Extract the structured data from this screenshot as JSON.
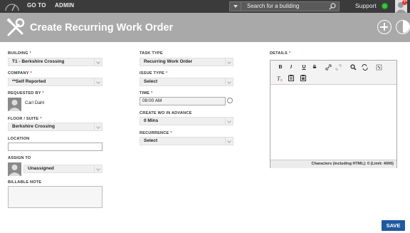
{
  "topbar": {
    "nav_goto": "GO TO",
    "nav_admin": "ADMIN",
    "search_placeholder": "Search for a building",
    "support_label": "Support",
    "status_color": "#2ecc2e",
    "notification_badge": "+"
  },
  "header": {
    "title": "Create Recurring Work Order",
    "band_color": "#a9a9a9"
  },
  "form": {
    "building": {
      "label": "BUILDING",
      "value": "T1 - Berkshire Crossing"
    },
    "company": {
      "label": "COMPANY",
      "value": "**Self Reported"
    },
    "requested_by": {
      "label": "REQUESTED BY",
      "value": "Carl Dahl"
    },
    "floor_suite": {
      "label": "FLOOR / SUITE",
      "value": "Berkshire Crossing"
    },
    "location": {
      "label": "LOCATION",
      "value": ""
    },
    "assign_to": {
      "label": "ASSIGN TO",
      "value": "Unassigned"
    },
    "billable_note": {
      "label": "BILLABLE NOTE",
      "value": ""
    },
    "task_type": {
      "label": "TASK TYPE",
      "value": "Recurring Work Order"
    },
    "issue_type": {
      "label": "ISSUE TYPE",
      "value": "Select"
    },
    "time": {
      "label": "TIME",
      "value": "08:00 AM"
    },
    "create_wo_in_advance": {
      "label": "CREATE WO IN ADVANCE",
      "value": "0 Mins"
    },
    "recurrence": {
      "label": "RECURRENCE",
      "value": "Select"
    },
    "details": {
      "label": "DETAILS",
      "value": ""
    },
    "required_marker": "*"
  },
  "editor": {
    "toolbar": [
      "bold",
      "italic",
      "underline",
      "strikethrough",
      "link",
      "unlink",
      "find",
      "replace",
      "select-all",
      "remove-format",
      "paste-text",
      "paste-word"
    ],
    "bold_label": "B",
    "italic_label": "I",
    "underline_label": "U",
    "strike_label": "S",
    "footer_text": "Characters (including HTML): 0 (Limit: 4000)"
  },
  "actions": {
    "save_label": "SAVE",
    "save_color": "#1d5a9e"
  }
}
